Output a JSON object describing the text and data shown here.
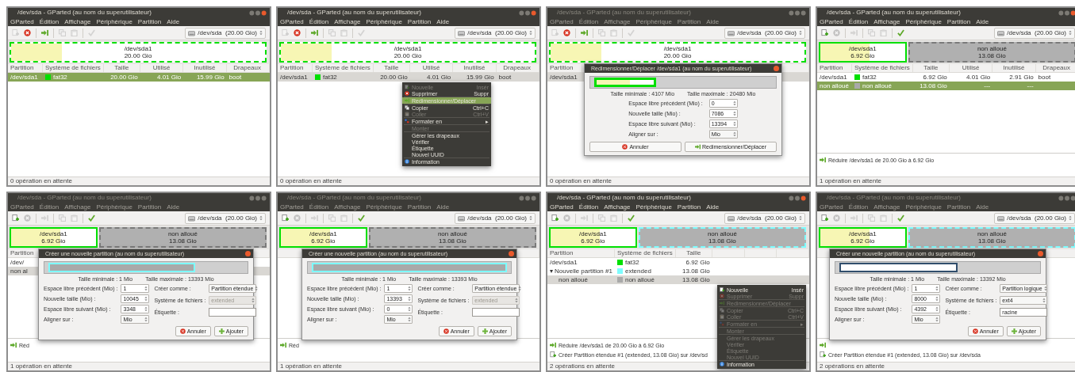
{
  "panels": [
    {
      "title": "/dev/sda - GParted (au nom du superutilisateur)",
      "title_active": true,
      "menu": [
        "GParted",
        "Édition",
        "Affichage",
        "Périphérique",
        "Partition",
        "Aide"
      ],
      "toolbar": [
        {
          "kind": "new",
          "enabled": false
        },
        {
          "kind": "delete",
          "enabled": true
        },
        {
          "kind": "resize",
          "enabled": true
        },
        {
          "kind": "copy",
          "enabled": false
        },
        {
          "kind": "paste",
          "enabled": false
        },
        {
          "kind": "apply",
          "enabled": false
        }
      ],
      "device": "/dev/sda  (20.00 Gio)",
      "disk_map": [
        {
          "kind": "fat32",
          "label": "/dev/sda1",
          "size": "20.00 Gio",
          "color": "#00e000",
          "selected": true,
          "share": {
            "level": 1
          },
          "used": {
            "level": 0.2
          }
        }
      ],
      "columns": {
        "partition": "Partition",
        "filesystem": "Système de fichiers",
        "size": "Taille",
        "used": "Utilisé",
        "unused": "Inutilisé",
        "flags": "Drapeaux"
      },
      "rows": [
        {
          "partition": "/dev/sda1",
          "color": "#00e000",
          "filesystem": "fat32",
          "size": "20.00 Gio",
          "used": "4.01 Gio",
          "unused": "15.99 Gio",
          "flags": "boot",
          "selected": true,
          "focused": true
        }
      ],
      "status": "0 opération en attente"
    },
    {
      "title": "/dev/sda - GParted (au nom du superutilisateur)",
      "title_active": true,
      "menu": [
        "GParted",
        "Édition",
        "Affichage",
        "Périphérique",
        "Partition",
        "Aide"
      ],
      "toolbar": [
        {
          "kind": "new",
          "enabled": false
        },
        {
          "kind": "delete",
          "enabled": true
        },
        {
          "kind": "resize",
          "enabled": true
        },
        {
          "kind": "copy",
          "enabled": false
        },
        {
          "kind": "paste",
          "enabled": false
        },
        {
          "kind": "apply",
          "enabled": false
        }
      ],
      "device": "/dev/sda  (20.00 Gio)",
      "disk_map": [
        {
          "kind": "fat32",
          "label": "/dev/sda1",
          "size": "20.00 Gio",
          "color": "#00e000",
          "selected": true,
          "share": {
            "level": 1
          },
          "used": {
            "level": 0.2
          }
        }
      ],
      "columns": {
        "partition": "Partition",
        "filesystem": "Système de fichiers",
        "size": "Taille",
        "used": "Utilisé",
        "unused": "Inutilisé",
        "flags": "Drapeaux"
      },
      "rows": [
        {
          "partition": "/dev/sda1",
          "color": "#00e000",
          "filesystem": "fat32",
          "size": "20.00 Gio",
          "used": "4.01 Gio",
          "unused": "15.99 Gio",
          "flags": "boot",
          "selected": true,
          "focused": false
        }
      ],
      "status": "0 opération en attente",
      "context_menu": {
        "items": [
          {
            "kind": "new",
            "label": "Nouvelle",
            "shortcut": "Insér",
            "disabled": true,
            "selected": false
          },
          {
            "kind": "delete",
            "label": "Supprimer",
            "shortcut": "Suppr",
            "disabled": false,
            "selected": false
          },
          {
            "kind": "separator"
          },
          {
            "kind": "resize",
            "label": "Redimensionner/Déplacer",
            "disabled": false,
            "selected": true
          },
          {
            "kind": "separator"
          },
          {
            "kind": "copy",
            "label": "Copier",
            "shortcut": "Ctrl+C",
            "disabled": false,
            "selected": false
          },
          {
            "kind": "paste",
            "label": "Coller",
            "shortcut": "Ctrl+V",
            "disabled": true,
            "selected": false
          },
          {
            "kind": "separator"
          },
          {
            "kind": "format",
            "label": "Formater en",
            "submenu": "▸",
            "disabled": false,
            "selected": false
          },
          {
            "kind": "separator"
          },
          {
            "kind": "plain",
            "label": "Monter",
            "disabled": true,
            "selected": false
          },
          {
            "kind": "separator"
          },
          {
            "kind": "plain",
            "label": "Gérer les drapeaux",
            "disabled": false,
            "selected": false
          },
          {
            "kind": "plain",
            "label": "Vérifier",
            "disabled": false,
            "selected": false
          },
          {
            "kind": "plain",
            "label": "Étiquette",
            "disabled": false,
            "selected": false
          },
          {
            "kind": "plain",
            "label": "Nouvel UUID",
            "disabled": false,
            "selected": false
          },
          {
            "kind": "separator"
          },
          {
            "kind": "info",
            "label": "Information",
            "disabled": false,
            "selected": false
          }
        ]
      }
    },
    {
      "title": "/dev/sda - GParted (au nom du superutilisateur)",
      "title_active": false,
      "menu": [
        "GParted",
        "Édition",
        "Affichage",
        "Périphérique",
        "Partition",
        "Aide"
      ],
      "toolbar": [
        {
          "kind": "new",
          "enabled": false
        },
        {
          "kind": "delete",
          "enabled": true
        },
        {
          "kind": "resize",
          "enabled": true
        },
        {
          "kind": "copy",
          "enabled": false
        },
        {
          "kind": "paste",
          "enabled": false
        },
        {
          "kind": "apply",
          "enabled": false
        }
      ],
      "device": "/dev/sda  (20.00 Gio)",
      "disk_map": [
        {
          "kind": "fat32",
          "label": "/dev/sda1",
          "size": "20.00 Gio",
          "color": "#00e000",
          "selected": true,
          "share": {
            "level": 1
          },
          "used": {
            "level": 0.2
          }
        }
      ],
      "columns": {
        "partition": "Partition"
      },
      "rows": [
        {
          "partition": "/dev/sda1",
          "selected": true,
          "focused": false
        }
      ],
      "status": "0 opération en attente",
      "dialog": {
        "kind": "resize",
        "title": "Redimensionner/Déplacer /dev/sda1 (au nom du superutilisateur)",
        "bar": {
          "kind": "fat32",
          "level": 0.35,
          "used": {
            "level": 0.58
          }
        },
        "min_size": "Taille minimale : 4107 Mio",
        "max_size": "Taille maximale : 20480 Mio",
        "fields": [
          {
            "label": "Espace libre précédent (Mio) :",
            "value": "0",
            "kind": "spin"
          },
          {
            "label": "Nouvelle taille (Mio) :",
            "value": "7086",
            "kind": "spin"
          },
          {
            "label": "Espace libre suivant (Mio) :",
            "value": "13394",
            "kind": "spin"
          },
          {
            "label": "Aligner sur :",
            "value": "Mio",
            "kind": "combo"
          }
        ],
        "buttons": [
          {
            "label": "Annuler",
            "kind": "cancel"
          },
          {
            "label": "Redimensionner/Déplacer",
            "kind": "resize"
          }
        ]
      }
    },
    {
      "title": "/dev/sda - GParted (au nom du superutilisateur)",
      "title_active": true,
      "menu": [
        "GParted",
        "Édition",
        "Affichage",
        "Périphérique",
        "Partition",
        "Aide"
      ],
      "toolbar": [
        {
          "kind": "new",
          "enabled": true
        },
        {
          "kind": "delete",
          "enabled": false
        },
        {
          "kind": "resize",
          "enabled": false
        },
        {
          "kind": "copy",
          "enabled": false
        },
        {
          "kind": "paste",
          "enabled": false
        },
        {
          "kind": "apply",
          "enabled": true
        }
      ],
      "device": "/dev/sda  (20.00 Gio)",
      "disk_map": [
        {
          "kind": "fat32",
          "label": "/dev/sda1",
          "size": "6.92 Gio",
          "color": "#00e000",
          "selected": false,
          "share": {
            "level": 0.346
          },
          "used": {
            "level": 0.58
          }
        },
        {
          "kind": "unallocated",
          "label": "non alloué",
          "size": "13.08 Gio",
          "color": "#7a7a7a",
          "selected": true,
          "share": {
            "level": 0.654
          }
        }
      ],
      "columns": {
        "partition": "Partition",
        "filesystem": "Système de fichiers",
        "size": "Taille",
        "used": "Utilisé",
        "unused": "Inutilisé",
        "flags": "Drapeaux"
      },
      "rows": [
        {
          "partition": "/dev/sda1",
          "color": "#00e000",
          "filesystem": "fat32",
          "size": "6.92 Gio",
          "used": "4.01 Gio",
          "unused": "2.91 Gio",
          "flags": "boot",
          "selected": false,
          "focused": false
        },
        {
          "partition": "non alloué",
          "color": "#a9a9a9",
          "filesystem": "non alloué",
          "size": "13.08 Gio",
          "used": "---",
          "unused": "---",
          "selected": true,
          "focused": true
        }
      ],
      "operations": [
        {
          "kind": "shrink",
          "label": "Réduire /dev/sda1 de 20.00 Gio à 6.92 Gio"
        }
      ],
      "status": "1 opération en attente"
    },
    {
      "title": "/dev/sda - GParted (au nom du superutilisateur)",
      "title_active": false,
      "menu": [
        "GParted",
        "Édition",
        "Affichage",
        "Périphérique",
        "Partition",
        "Aide"
      ],
      "toolbar": [
        {
          "kind": "new",
          "enabled": true
        },
        {
          "kind": "delete",
          "enabled": false
        },
        {
          "kind": "resize",
          "enabled": false
        },
        {
          "kind": "copy",
          "enabled": false
        },
        {
          "kind": "paste",
          "enabled": false
        },
        {
          "kind": "apply",
          "enabled": true
        }
      ],
      "device": "/dev/sda  (20.00 Gio)",
      "disk_map": [
        {
          "kind": "fat32",
          "label": "/dev/sda1",
          "size": "6.92 Gio",
          "color": "#00e000",
          "selected": false,
          "share": {
            "level": 0.346
          },
          "used": {
            "level": 0.58
          }
        },
        {
          "kind": "unallocated",
          "label": "non alloué",
          "size": "13.08 Gio",
          "color": "#7a7a7a",
          "selected": true,
          "share": {
            "level": 0.654
          }
        }
      ],
      "columns": {
        "partition": "Partition"
      },
      "rows": [
        {
          "partition": "/dev/",
          "selected": false,
          "focused": false
        },
        {
          "partition": "non al",
          "selected": true,
          "focused": false
        }
      ],
      "operations": [
        {
          "kind": "shrink",
          "label": "Réd"
        }
      ],
      "status": "1 opération en attente",
      "dialog": {
        "kind": "create",
        "title": "Créer une nouvelle partition (au nom du superutilisateur)",
        "bar": {
          "kind": "extended",
          "level": 0.75
        },
        "min_size": "Taille minimale : 1 Mio",
        "max_size": "Taille maximale : 13393 Mio",
        "fields": [
          {
            "label": "Espace libre précédent (Mio) :",
            "value": "1",
            "kind": "spin"
          },
          {
            "label": "Nouvelle taille (Mio) :",
            "value": "10045",
            "kind": "spin"
          },
          {
            "label": "Espace libre suivant (Mio) :",
            "value": "3348",
            "kind": "spin"
          },
          {
            "label": "Aligner sur :",
            "value": "Mio",
            "kind": "combo"
          }
        ],
        "options": [
          {
            "label": "Créer comme :",
            "value": "Partition étendue",
            "kind": "combo",
            "disabled": false
          },
          {
            "label": "Système de fichiers :",
            "value": "extended",
            "kind": "combo",
            "disabled": true
          },
          {
            "label": "Étiquette :",
            "kind": "text",
            "disabled": false
          }
        ],
        "buttons": [
          {
            "label": "Annuler",
            "kind": "cancel"
          },
          {
            "label": "Ajouter",
            "kind": "add"
          }
        ]
      }
    },
    {
      "title": "/dev/sda - GParted (au nom du superutilisateur)",
      "title_active": false,
      "menu": [
        "GParted",
        "Édition",
        "Affichage",
        "Périphérique",
        "Partition",
        "Aide"
      ],
      "toolbar": [
        {
          "kind": "new",
          "enabled": true
        },
        {
          "kind": "delete",
          "enabled": false
        },
        {
          "kind": "resize",
          "enabled": false
        },
        {
          "kind": "copy",
          "enabled": false
        },
        {
          "kind": "paste",
          "enabled": false
        },
        {
          "kind": "apply",
          "enabled": true
        }
      ],
      "device": "/dev/sda  (20.00 Gio)",
      "disk_map": [
        {
          "kind": "fat32",
          "label": "/dev/sda1",
          "size": "6.92 Gio",
          "color": "#00e000",
          "selected": false,
          "share": {
            "level": 0.346
          },
          "used": {
            "level": 0.58
          }
        },
        {
          "kind": "unallocated",
          "label": "non alloué",
          "size": "13.08 Gio",
          "color": "#7a7a7a",
          "selected": true,
          "share": {
            "level": 0.654
          }
        }
      ],
      "operations": [
        {
          "kind": "shrink",
          "label": "Réd"
        }
      ],
      "status": "1 opération en attente",
      "dialog": {
        "kind": "create",
        "title": "Créer une nouvelle partition (au nom du superutilisateur)",
        "bar": {
          "kind": "extended",
          "level": 1
        },
        "min_size": "Taille minimale : 1 Mio",
        "max_size": "Taille maximale : 13393 Mio",
        "fields": [
          {
            "label": "Espace libre précédent (Mio) :",
            "value": "1",
            "kind": "spin"
          },
          {
            "label": "Nouvelle taille (Mio) :",
            "value": "13393",
            "kind": "spin"
          },
          {
            "label": "Espace libre suivant (Mio) :",
            "value": "0",
            "kind": "spin"
          },
          {
            "label": "Aligner sur :",
            "value": "Mio",
            "kind": "combo"
          }
        ],
        "options": [
          {
            "label": "Créer comme :",
            "value": "Partition étendue",
            "kind": "combo",
            "disabled": false
          },
          {
            "label": "Système de fichiers :",
            "value": "extended",
            "kind": "combo",
            "disabled": true
          },
          {
            "label": "Étiquette :",
            "kind": "text",
            "disabled": false
          }
        ],
        "buttons": [
          {
            "label": "Annuler",
            "kind": "cancel"
          },
          {
            "label": "Ajouter",
            "kind": "add"
          }
        ]
      }
    },
    {
      "title": "/dev/sda - GParted (au nom du superutilisateur)",
      "title_active": true,
      "menu": [
        "GParted",
        "Édition",
        "Affichage",
        "Périphérique",
        "Partition",
        "Aide"
      ],
      "toolbar": [
        {
          "kind": "new",
          "enabled": true
        },
        {
          "kind": "delete",
          "enabled": false
        },
        {
          "kind": "resize",
          "enabled": false
        },
        {
          "kind": "copy",
          "enabled": false
        },
        {
          "kind": "paste",
          "enabled": false
        },
        {
          "kind": "apply",
          "enabled": true
        }
      ],
      "device": "/dev/sda  (20.00 Gio)",
      "disk_map": [
        {
          "kind": "fat32",
          "label": "/dev/sda1",
          "size": "6.92 Gio",
          "color": "#00e000",
          "selected": false,
          "share": {
            "level": 0.346
          },
          "used": {
            "level": 0.58
          }
        },
        {
          "kind": "extended",
          "label": "non alloué",
          "size": "13.08 Gio",
          "color": "#7dfcfe",
          "selected": true,
          "share": {
            "level": 0.654
          }
        }
      ],
      "columns": {
        "partition": "Partition",
        "filesystem": "Système de fichiers",
        "size": "Taille"
      },
      "rows": [
        {
          "partition": "/dev/sda1",
          "color": "#00e000",
          "filesystem": "fat32",
          "size": "6.92 Gio",
          "selected": false,
          "focused": false
        },
        {
          "partition": "Nouvelle partition #1",
          "expander": "▾",
          "color": "#7dfcfe",
          "filesystem": "extended",
          "size": "13.08 Gio",
          "selected": false,
          "focused": false,
          "children": [
            {
              "partition": "non alloué",
              "color": "#a9a9a9",
              "filesystem": "non alloué",
              "size": "13.08 Gio",
              "selected": true,
              "focused": false
            }
          ]
        }
      ],
      "operations": [
        {
          "kind": "shrink",
          "label": "Réduire /dev/sda1 de 20.00 Gio à 6.92 Gio"
        },
        {
          "kind": "create",
          "label": "Créer Partition étendue #1 (extended, 13.08 Gio) sur /dev/sd"
        }
      ],
      "status": "2 opérations en attente",
      "context_menu": {
        "items": [
          {
            "kind": "new",
            "label": "Nouvelle",
            "shortcut": "Insér",
            "disabled": false,
            "selected": false
          },
          {
            "kind": "delete",
            "label": "Supprimer",
            "shortcut": "Suppr",
            "disabled": true,
            "selected": false
          },
          {
            "kind": "separator"
          },
          {
            "kind": "resize",
            "label": "Redimensionner/Déplacer",
            "disabled": true,
            "selected": false
          },
          {
            "kind": "separator"
          },
          {
            "kind": "copy",
            "label": "Copier",
            "shortcut": "Ctrl+C",
            "disabled": true,
            "selected": false
          },
          {
            "kind": "paste",
            "label": "Coller",
            "shortcut": "Ctrl+V",
            "disabled": true,
            "selected": false
          },
          {
            "kind": "separator"
          },
          {
            "kind": "format",
            "label": "Formater en",
            "submenu": "▸",
            "disabled": true,
            "selected": false
          },
          {
            "kind": "separator"
          },
          {
            "kind": "plain",
            "label": "Monter",
            "disabled": true,
            "selected": false
          },
          {
            "kind": "separator"
          },
          {
            "kind": "plain",
            "label": "Gérer les drapeaux",
            "disabled": true,
            "selected": false
          },
          {
            "kind": "plain",
            "label": "Vérifier",
            "disabled": true,
            "selected": false
          },
          {
            "kind": "plain",
            "label": "Étiquette",
            "disabled": true,
            "selected": false
          },
          {
            "kind": "plain",
            "label": "Nouvel UUID",
            "disabled": true,
            "selected": false
          },
          {
            "kind": "separator"
          },
          {
            "kind": "info",
            "label": "Information",
            "disabled": false,
            "selected": false
          }
        ]
      }
    },
    {
      "title": "/dev/sda - GParted (au nom du superutilisateur)",
      "title_active": false,
      "menu": [
        "GParted",
        "Édition",
        "Affichage",
        "Périphérique",
        "Partition",
        "Aide"
      ],
      "toolbar": [
        {
          "kind": "new",
          "enabled": true
        },
        {
          "kind": "delete",
          "enabled": false
        },
        {
          "kind": "resize",
          "enabled": false
        },
        {
          "kind": "copy",
          "enabled": false
        },
        {
          "kind": "paste",
          "enabled": false
        },
        {
          "kind": "apply",
          "enabled": true
        }
      ],
      "device": "/dev/sda  (20.00 Gio)",
      "disk_map": [
        {
          "kind": "fat32",
          "label": "/dev/sda1",
          "size": "6.92 Gio",
          "color": "#00e000",
          "selected": false,
          "share": {
            "level": 0.346
          },
          "used": {
            "level": 0.58
          }
        },
        {
          "kind": "extended",
          "label": "non alloué",
          "size": "13.08 Gio",
          "color": "#7dfcfe",
          "selected": true,
          "share": {
            "level": 0.654
          }
        }
      ],
      "operations": [
        {
          "kind": "shrink"
        },
        {
          "kind": "create",
          "label": "Créer Partition étendue #1 (extended, 13.08 Gio) sur /dev/sda"
        }
      ],
      "status": "2 opérations en attente",
      "dialog": {
        "kind": "create",
        "title": "Créer une nouvelle partition (au nom du superutilisateur)",
        "bar": {
          "kind": "ext4",
          "level": 0.6
        },
        "min_size": "Taille minimale : 1 Mio",
        "max_size": "Taille maximale : 13392 Mio",
        "fields": [
          {
            "label": "Espace libre précédent (Mio) :",
            "value": "1",
            "kind": "spin"
          },
          {
            "label": "Nouvelle taille (Mio) :",
            "value": "8000",
            "kind": "spin"
          },
          {
            "label": "Espace libre suivant (Mio) :",
            "value": "4392",
            "kind": "spin"
          },
          {
            "label": "Aligner sur :",
            "value": "Mio",
            "kind": "combo"
          }
        ],
        "options": [
          {
            "label": "Créer comme :",
            "value": "Partition logique",
            "kind": "combo",
            "disabled": false
          },
          {
            "label": "Système de fichiers :",
            "value": "ext4",
            "kind": "combo",
            "disabled": false
          },
          {
            "label": "Étiquette :",
            "value": "racine",
            "kind": "text",
            "disabled": false
          }
        ],
        "buttons": [
          {
            "label": "Annuler",
            "kind": "cancel"
          },
          {
            "label": "Ajouter",
            "kind": "add"
          }
        ]
      }
    }
  ]
}
